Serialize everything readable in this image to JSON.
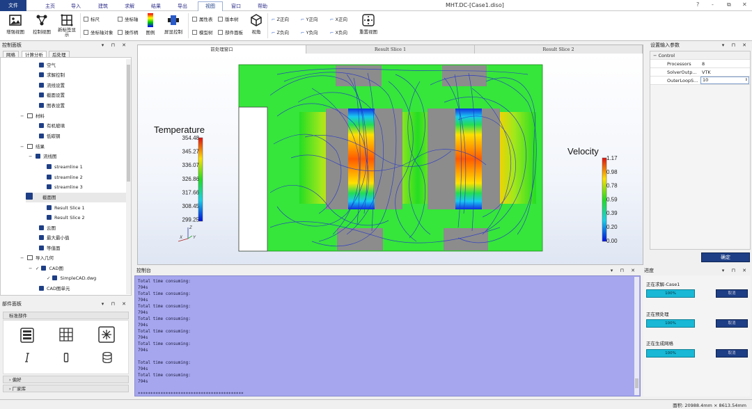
{
  "window": {
    "title": "MHT.DC-[Case1.diso]",
    "min": "-",
    "restore": "⧉",
    "close": "✕",
    "pin": "▫"
  },
  "tabs": [
    {
      "label": "文件"
    },
    {
      "label": "主页"
    },
    {
      "label": "导入"
    },
    {
      "label": "建筑"
    },
    {
      "label": "求解"
    },
    {
      "label": "结果"
    },
    {
      "label": "导出"
    },
    {
      "label": "视图"
    },
    {
      "label": "窗口"
    },
    {
      "label": "帮助"
    }
  ],
  "ribbon": {
    "buttons": [
      {
        "label": "增强视图",
        "icon": "picture-icon"
      },
      {
        "label": "控制视图",
        "icon": "nodes-icon"
      },
      {
        "label": "新标签显示",
        "icon": "grid-icon"
      },
      {
        "label": "图例",
        "icon": "legend-icon"
      },
      {
        "label": "屏显控制",
        "icon": "display-icon"
      },
      {
        "label": "视角",
        "icon": "cube-icon"
      },
      {
        "label": "重置视图",
        "icon": "reset-view-icon"
      }
    ],
    "checks": [
      "标尺",
      "坐标轴",
      "坐标轴对象",
      "操作柄",
      "属性表",
      "版本树",
      "模型树",
      "部件面板"
    ],
    "views": [
      "Z正向",
      "Y正向",
      "X正向",
      "Z负向",
      "Y负向",
      "X负向"
    ]
  },
  "control_panel": {
    "title": "控制面板",
    "tabs": [
      "网格",
      "计算分析",
      "后处理"
    ],
    "items": [
      {
        "label": "空气"
      },
      {
        "label": "求解控制"
      },
      {
        "label": "流线设置"
      },
      {
        "label": "截面设置"
      },
      {
        "label": "图表设置"
      },
      {
        "label": "材料"
      },
      {
        "label": "有机玻璃"
      },
      {
        "label": "低碳钢"
      },
      {
        "label": "结果"
      },
      {
        "label": "流线图"
      },
      {
        "label": "streamline 1"
      },
      {
        "label": "streamline 2"
      },
      {
        "label": "streamline 3"
      },
      {
        "label": "截面图"
      },
      {
        "label": "Result Slice 1"
      },
      {
        "label": "Result Slice 2"
      },
      {
        "label": "云图"
      },
      {
        "label": "最大最小值"
      },
      {
        "label": "等值面"
      },
      {
        "label": "导入几何"
      },
      {
        "label": "CAD图"
      },
      {
        "label": "SimpleCAD.dwg"
      },
      {
        "label": "CAD图单元"
      }
    ]
  },
  "parts_panel": {
    "title": "部件面板",
    "sections": [
      "标准部件",
      "偏好",
      "厂家库"
    ]
  },
  "viewport": {
    "tabs": [
      "前处理窗口",
      "Result Slice 1",
      "Result Slice 2"
    ],
    "temp_legend": {
      "title": "Temperature",
      "ticks": [
        "354.48",
        "345.27",
        "336.07",
        "326.86",
        "317.66",
        "308.45",
        "299.25"
      ]
    },
    "vel_legend": {
      "title": "Velocity",
      "ticks": [
        "1.17",
        "0.98",
        "0.78",
        "0.59",
        "0.39",
        "0.20",
        "0.00"
      ]
    },
    "axes": {
      "z": "Z",
      "x": "X",
      "y": "Y"
    }
  },
  "console": {
    "title": "控制台",
    "lines": [
      "Total time consuming:",
      "794s",
      "Total time consuming:",
      "794s",
      "Total time consuming:",
      "794s",
      "Total time consuming:",
      "794s",
      "Total time consuming:",
      "794s",
      "Total time consuming:",
      "794s",
      "",
      "Total time consuming:",
      "794s",
      "Total time consuming:",
      "794s",
      "",
      "******************************************"
    ]
  },
  "params": {
    "title": "设置输入参数",
    "group": "Control",
    "rows": [
      {
        "key": "Processors",
        "value": "8"
      },
      {
        "key": "SolverOutp...",
        "value": "VTK"
      },
      {
        "key": "OuterLoopS...",
        "value": "10"
      }
    ],
    "confirm": "确定"
  },
  "progress": {
    "title": "进度",
    "tasks": [
      {
        "label": "正在求解-Case1",
        "value": "100%",
        "cancel": "取消"
      },
      {
        "label": "正在预处理",
        "value": "100%",
        "cancel": "取消"
      },
      {
        "label": "正在生成网格",
        "value": "100%",
        "cancel": "取消"
      }
    ]
  },
  "status": {
    "text": "面积: 20988.4mm × 8613.54mm"
  },
  "colors": {
    "accent": "#1e3f86",
    "console_bg": "#a5a6ee",
    "progress": "#19b8d6"
  }
}
